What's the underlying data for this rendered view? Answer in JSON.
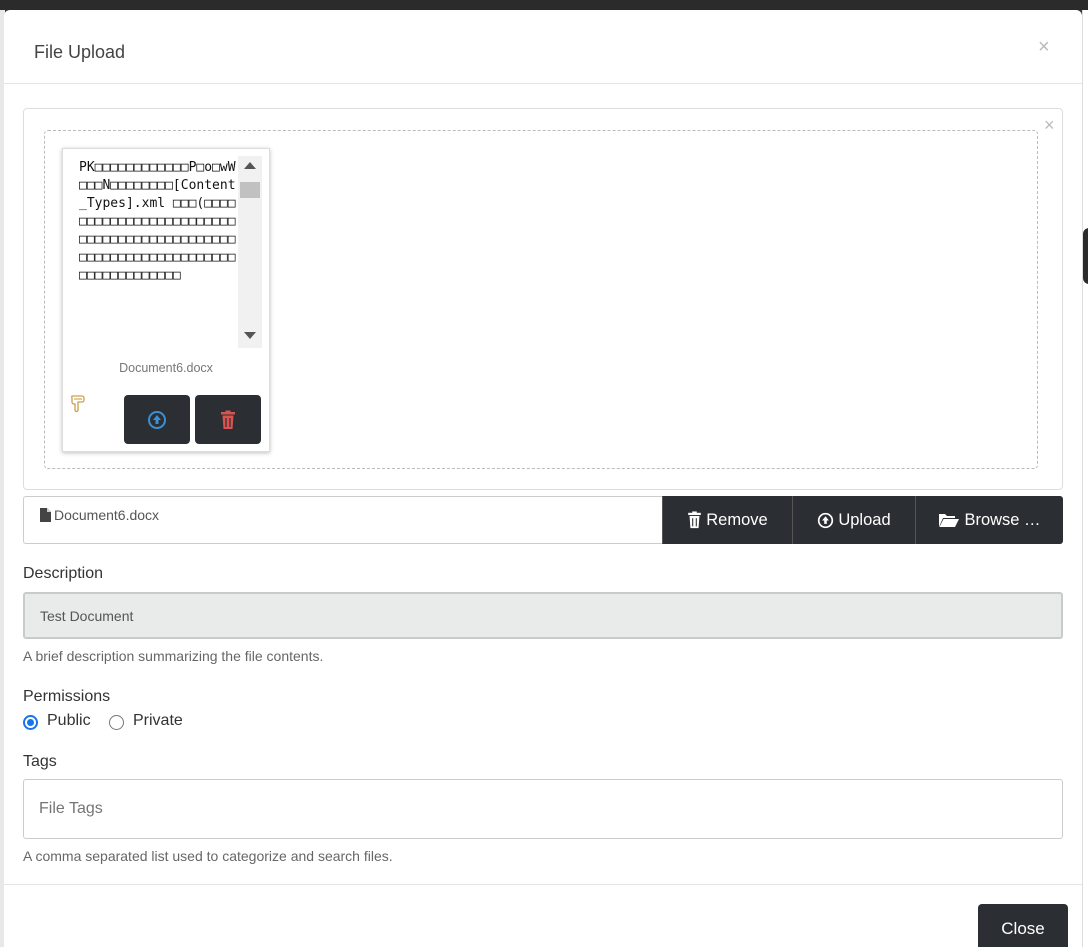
{
  "modal": {
    "title": "File Upload",
    "close_symbol": "×"
  },
  "preview": {
    "close_symbol": "×",
    "text": "PK□□□□□□□□□□□□P□o□wW□□□N□□□□□□□□[Content_Types].xml □□□(□□□□□□□□□□□□□□□□□□□□□□□□□□□□□□□□□□□□□□□□□□□□□□□□□□□□□□□□□□□□□□□□□□□□□□□□□□□□□",
    "file_name": "Document6.docx",
    "icons": [
      "hand-pointer-icon",
      "upload-circle-icon",
      "trash-icon"
    ]
  },
  "file_row": {
    "file_name": "Document6.docx",
    "remove_label": "Remove",
    "upload_label": "Upload",
    "browse_label": "Browse …"
  },
  "description": {
    "label": "Description",
    "value": "Test Document",
    "help": "A brief description summarizing the file contents."
  },
  "permissions": {
    "label": "Permissions",
    "options": [
      "Public",
      "Private"
    ],
    "selected": "Public"
  },
  "tags": {
    "label": "Tags",
    "placeholder": "File Tags",
    "help": "A comma separated list used to categorize and search files."
  },
  "footer": {
    "close_label": "Close"
  },
  "colors": {
    "button_dark": "#2b2f33",
    "upload_icon": "#3a8fd6",
    "trash_icon": "#d9534f",
    "radio_accent": "#1a73e8"
  }
}
